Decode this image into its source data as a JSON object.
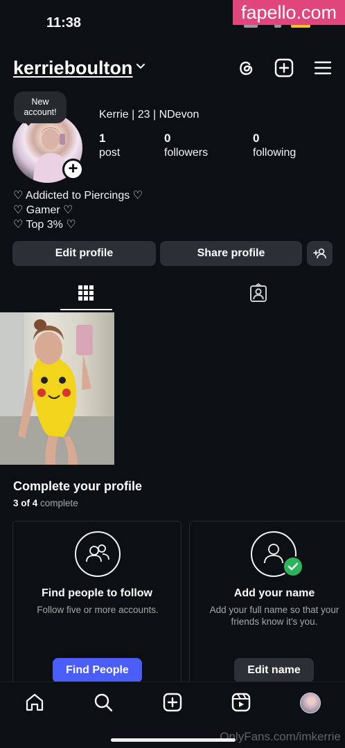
{
  "status_bar": {
    "time": "11:38"
  },
  "watermark_top": "fapello.com",
  "header": {
    "username": "kerrieboulton",
    "icons": [
      "threads-icon",
      "create-post-icon",
      "menu-icon"
    ]
  },
  "profile": {
    "new_account_bubble": "New\naccount!",
    "full_name": "Kerrie | 23 | NDevon",
    "stats": [
      {
        "value": "1",
        "label": "post"
      },
      {
        "value": "0",
        "label": "followers"
      },
      {
        "value": "0",
        "label": "following"
      }
    ],
    "bio": [
      "♡ Addicted to Piercings ♡",
      "♡ Gamer ♡",
      "♡ Top 3% ♡"
    ]
  },
  "actions": {
    "edit_profile": "Edit profile",
    "share_profile": "Share profile"
  },
  "tabs": [
    "grid-icon",
    "tagged-icon"
  ],
  "complete_profile": {
    "title": "Complete your profile",
    "progress_count": "3 of 4",
    "progress_suffix": " complete",
    "cards": [
      {
        "title": "Find people to follow",
        "description": "Follow five or more accounts.",
        "button": "Find People"
      },
      {
        "title": "Add your name",
        "description": "Add your full name so that your friends know it's you.",
        "button": "Edit name"
      }
    ]
  },
  "bottom_nav": [
    "home-icon",
    "search-icon",
    "create-icon",
    "reels-icon",
    "profile-avatar"
  ],
  "watermark_bottom": "OnlyFans.com/imkerrie",
  "colors": {
    "background": "#0c1014",
    "button_gray": "#2b3036",
    "accent_blue": "#4a5df9",
    "check_green": "#2ab55d",
    "watermark_pink": "#e0457b"
  }
}
